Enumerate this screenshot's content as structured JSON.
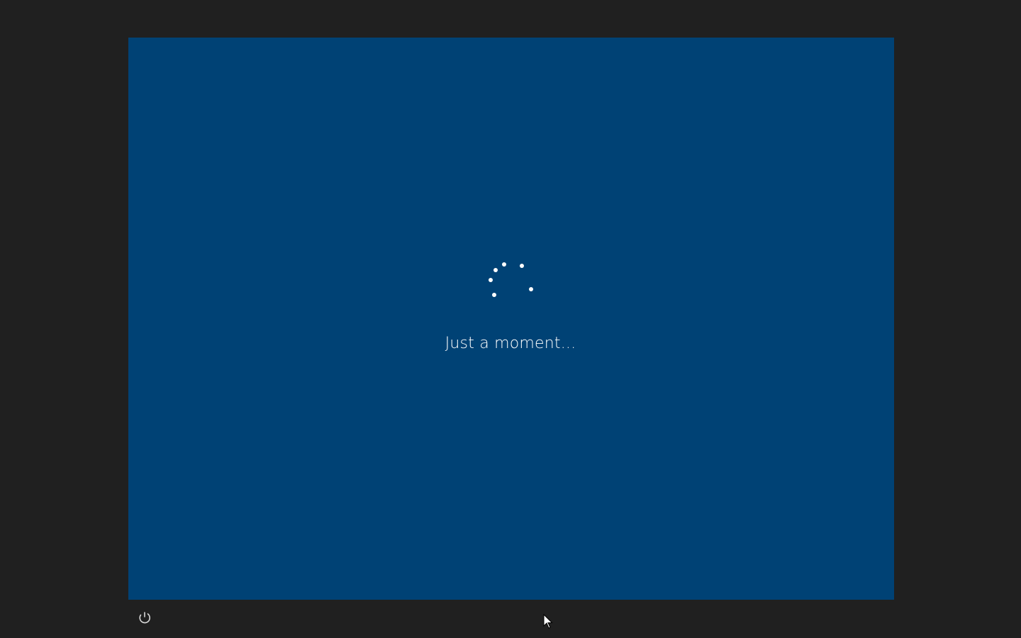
{
  "screen": {
    "background_color": "#004275",
    "status_text": "Just a moment...",
    "spinner_icon": "loading-spinner-icon"
  },
  "bottom_bar": {
    "background_color": "#202020",
    "power_icon": "power-options-icon"
  },
  "cursor_icon": "mouse-pointer-icon"
}
